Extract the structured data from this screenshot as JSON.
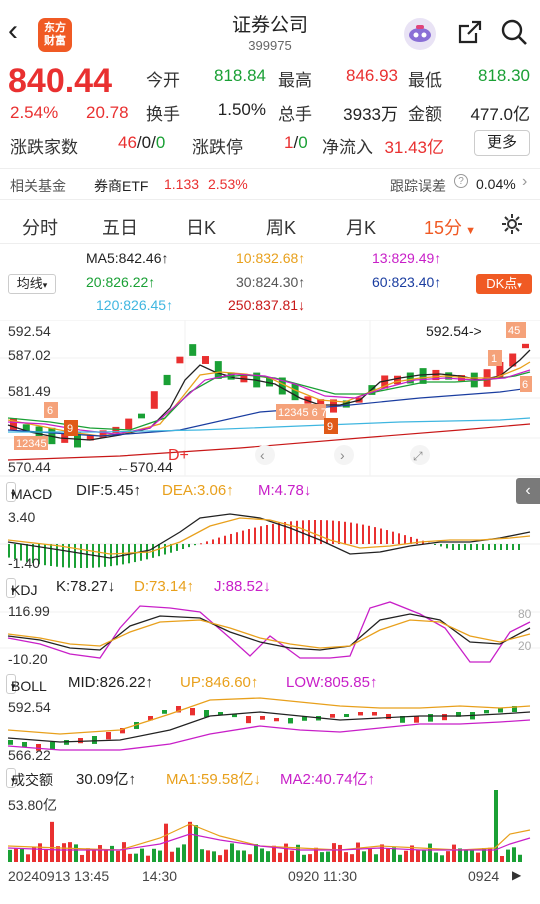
{
  "header": {
    "back_icon": "chevron-left-icon",
    "logo_text": "东方财富",
    "title": "证券公司",
    "code": "399975"
  },
  "quote": {
    "price": "840.44",
    "change_pct": "2.54%",
    "change": "20.78",
    "open_label": "今开",
    "open": "818.84",
    "high_label": "最高",
    "high": "846.93",
    "low_label": "最低",
    "low": "818.30",
    "turnover_label": "换手",
    "turnover": "1.50%",
    "volume_label": "总手",
    "volume": "3933万",
    "amount_label": "金额",
    "amount": "477.0亿",
    "breadth_label": "涨跌家数",
    "breadth_a": "46",
    "breadth_b": "0",
    "breadth_c": "0",
    "limit_label": "涨跌停",
    "limit_a": "1",
    "limit_b": "0",
    "netflow_label": "净流入",
    "netflow": "31.43亿",
    "more_label": "更多",
    "colors": {
      "up": "#e93030",
      "down": "#1aa035"
    }
  },
  "fund": {
    "label": "相关基金",
    "name": "券商ETF",
    "price": "1.133",
    "pct": "2.53%",
    "tracking_label": "跟踪误差",
    "tracking": "0.04%"
  },
  "tabs": [
    "分时",
    "五日",
    "日K",
    "周K",
    "月K",
    "15分",
    "settings-icon"
  ],
  "ma": {
    "selector": "均线",
    "dk_button": "DK点",
    "items": [
      {
        "text": "MA5:842.46↑",
        "color": "#222"
      },
      {
        "text": "10:832.68↑",
        "color": "#e8a01c"
      },
      {
        "text": "13:829.49↑",
        "color": "#c81fc8"
      },
      {
        "text": "20:826.22↑",
        "color": "#1aa035"
      },
      {
        "text": "30:824.30↑",
        "color": "#666"
      },
      {
        "text": "60:823.40↑",
        "color": "#1a3da0"
      },
      {
        "text": "120:826.45↑",
        "color": "#3fb6e0"
      },
      {
        "text": "250:837.81↓",
        "color": "#c81818"
      }
    ]
  },
  "kline": {
    "y_top": "592.54",
    "y_mid": "587.02",
    "y_low": "581.49",
    "y_bottom": "570.44",
    "min_label": "570.44",
    "max_label": "592.54"
  },
  "macd": {
    "selector": "MACD",
    "dif": "DIF:5.45↑",
    "dea": "DEA:3.06↑",
    "m": "M:4.78↓",
    "y_top": "3.40",
    "y_bottom": "-1.40"
  },
  "kdj": {
    "selector": "KDJ",
    "k": "K:78.27↓",
    "d": "D:73.14↑",
    "j": "J:88.52↓",
    "y_top": "116.99",
    "y_bottom": "-10.20",
    "right_top": "80",
    "right_bottom": "20"
  },
  "boll": {
    "selector": "BOLL",
    "mid": "MID:826.22↑",
    "up": "UP:846.60↑",
    "low": "LOW:805.85↑",
    "y_top": "592.54",
    "y_bottom": "566.22"
  },
  "vol": {
    "selector": "成交额",
    "value": "30.09亿↑",
    "ma1": "MA1:59.58亿↓",
    "ma2": "MA2:40.74亿↑",
    "y_top": "53.80亿"
  },
  "time_axis": [
    "20240913 13:45",
    "14:30",
    "0920 11:30",
    "0924"
  ]
}
